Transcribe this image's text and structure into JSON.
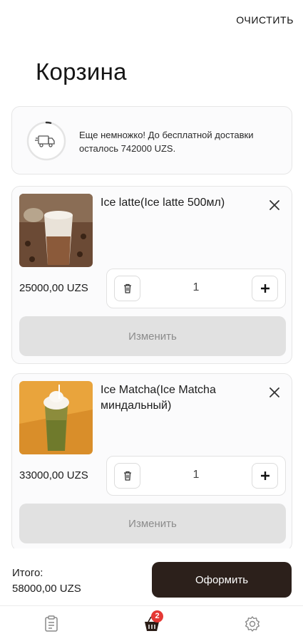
{
  "header": {
    "clear_label": "ОЧИСТИТЬ",
    "title": "Корзина"
  },
  "delivery": {
    "icon": "truck-icon",
    "message": "Еще немножко! До бесплатной доставки осталось 742000 UZS.",
    "progress": 0.03
  },
  "cart": {
    "items": [
      {
        "name": "Ice latte(Ice latte 500мл)",
        "price": "25000,00 UZS",
        "quantity": "1",
        "edit_label": "Изменить"
      },
      {
        "name": "Ice Matcha(Ice Matcha миндальный)",
        "price": "33000,00 UZS",
        "quantity": "1",
        "edit_label": "Изменить"
      }
    ]
  },
  "footer": {
    "total_label": "Итого:",
    "total_value": "58000,00 UZS",
    "checkout_label": "Оформить"
  },
  "nav": {
    "items": [
      {
        "icon": "orders-icon"
      },
      {
        "icon": "cart-icon",
        "badge": "2"
      },
      {
        "icon": "settings-icon"
      }
    ]
  },
  "colors": {
    "checkout_bg": "#2c201b",
    "badge_bg": "#e53935",
    "edit_bg": "#e1e1e1"
  }
}
